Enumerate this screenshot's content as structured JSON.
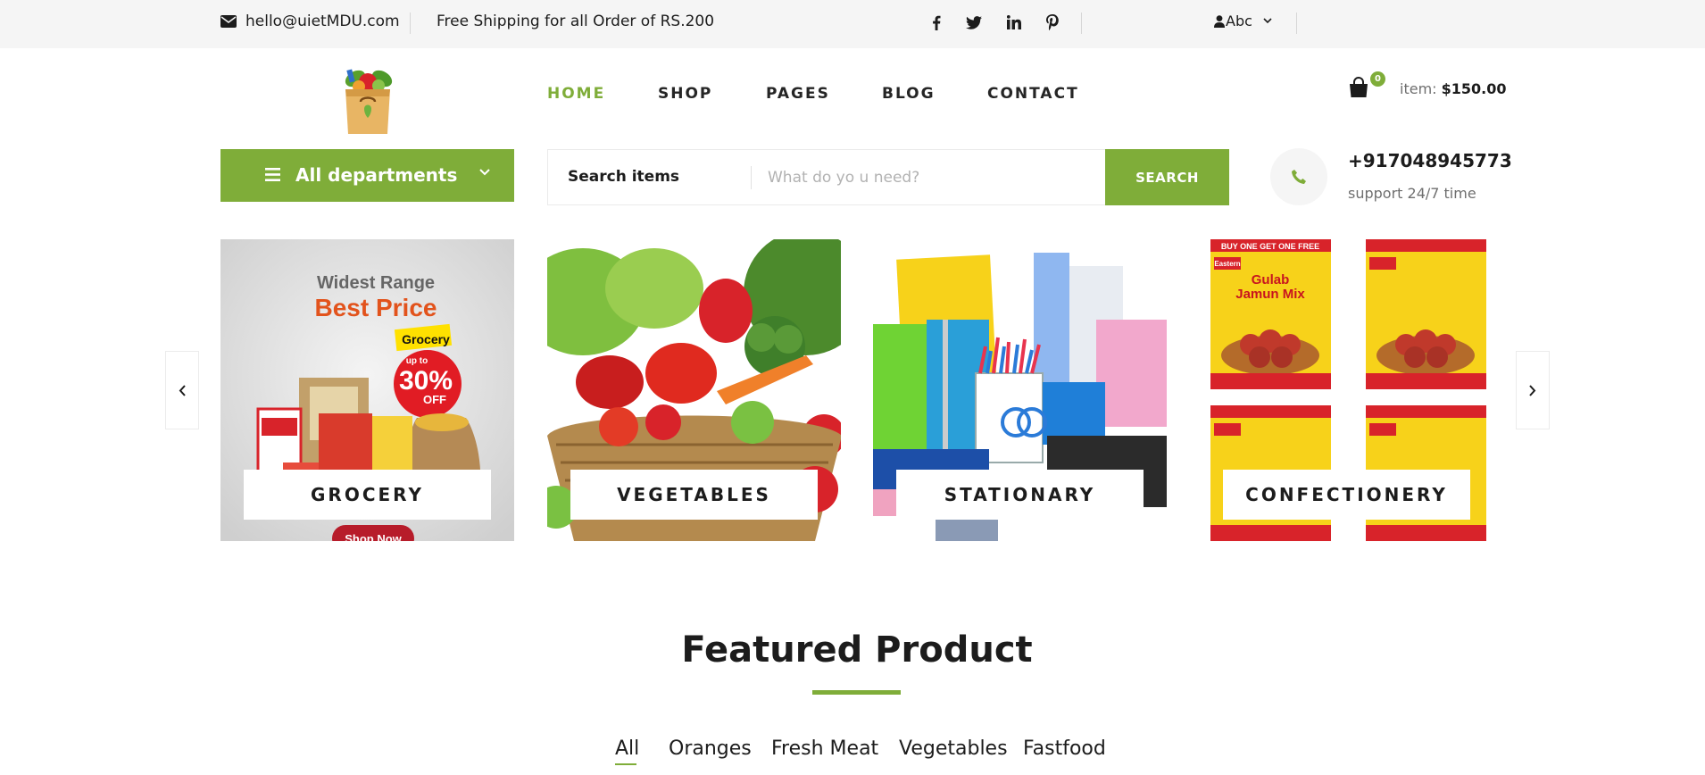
{
  "topbar": {
    "email": "hello@uietMDU.com",
    "shipping": "Free Shipping for all Order of RS.200",
    "social": [
      "facebook-icon",
      "twitter-icon",
      "linkedin-icon",
      "pinterest-icon"
    ],
    "user_label": "Abc"
  },
  "nav": {
    "items": [
      {
        "label": "HOME",
        "active": true
      },
      {
        "label": "SHOP",
        "active": false
      },
      {
        "label": "PAGES",
        "active": false
      },
      {
        "label": "BLOG",
        "active": false
      },
      {
        "label": "CONTACT",
        "active": false
      }
    ]
  },
  "cart": {
    "count": "0",
    "item_prefix": "item:",
    "total": "$150.00"
  },
  "departments": {
    "label": "All departments"
  },
  "search": {
    "category": "Search items",
    "placeholder": "What do yo u need?",
    "button": "SEARCH"
  },
  "contact": {
    "phone": "+917048945773",
    "support": "support 24/7 time"
  },
  "categories": [
    {
      "label": "GROCERY",
      "promo_line1": "Widest Range",
      "promo_line2": "Best Price",
      "promo_tag": "Grocery",
      "promo_upto": "up to",
      "promo_pct": "30%",
      "promo_off": "OFF",
      "promo_btn": "Shop Now"
    },
    {
      "label": "VEGETABLES"
    },
    {
      "label": "STATIONARY"
    },
    {
      "label": "CONFECTIONERY",
      "pack_banner": "BUY ONE GET ONE FREE",
      "pack_brand": "Eastern",
      "pack_line1": "Gulab",
      "pack_line2": "Jamun Mix"
    }
  ],
  "featured": {
    "title": "Featured Product",
    "filters": [
      "All",
      "Oranges",
      "Fresh Meat",
      "Vegetables",
      "Fastfood"
    ]
  },
  "colors": {
    "accent": "#7fad39",
    "topbar_bg": "#f5f5f5"
  }
}
